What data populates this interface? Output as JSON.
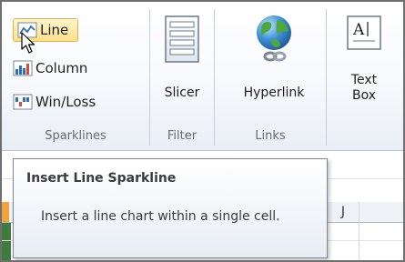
{
  "ribbon": {
    "sparklines": {
      "line_label": "Line",
      "column_label": "Column",
      "winloss_label": "Win/Loss",
      "group_label": "Sparklines"
    },
    "filter": {
      "slicer_label": "Slicer",
      "group_label": "Filter"
    },
    "links": {
      "hyperlink_label": "Hyperlink",
      "group_label": "Links"
    },
    "text": {
      "textbox_line1": "Text",
      "textbox_line2": "Box"
    }
  },
  "sheet": {
    "visible_column": "J"
  },
  "tooltip": {
    "title": "Insert Line Sparkline",
    "body": "Insert a line chart within a single cell."
  },
  "colors": {
    "hover_fill": "#ffe08a",
    "hover_border": "#e3b347",
    "tooltip_border": "#7f8791",
    "ribbon_background": "#f7f9fc",
    "selected_column_accent": "#f2a23a"
  }
}
